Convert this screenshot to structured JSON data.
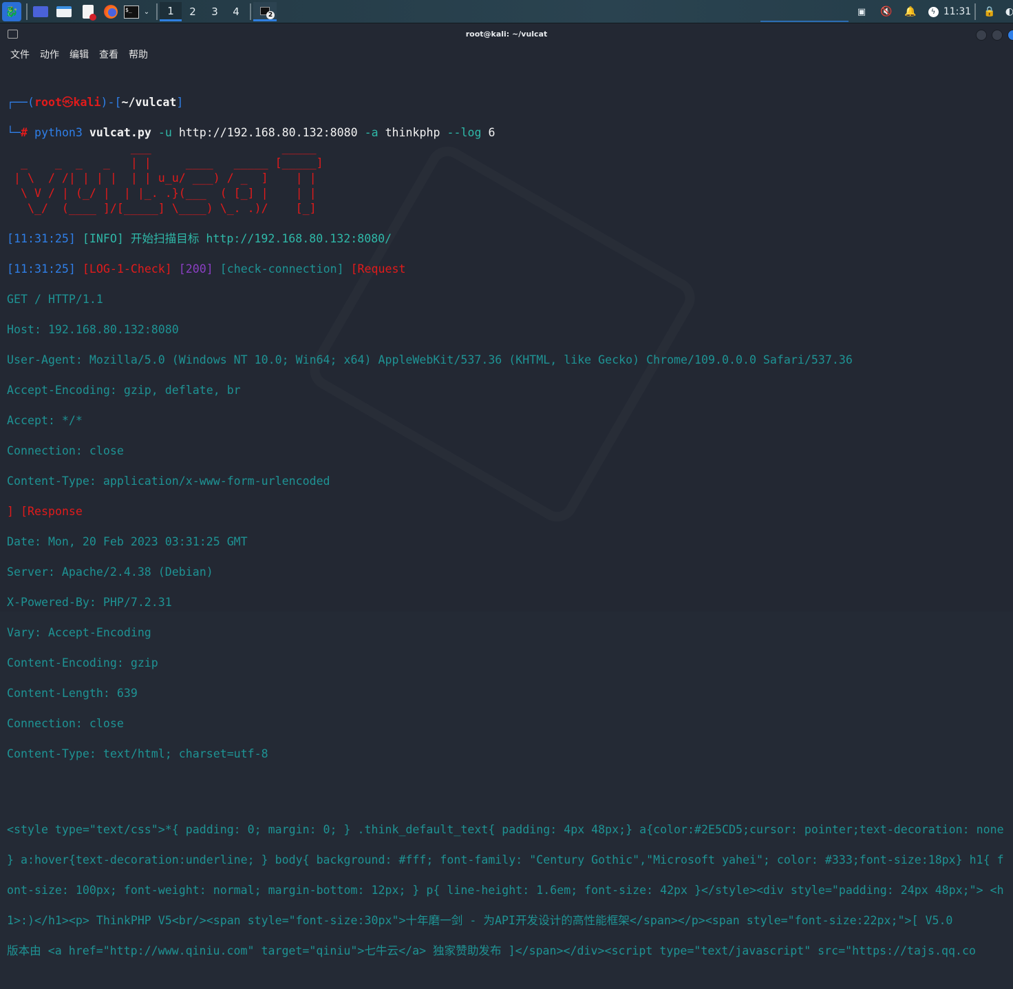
{
  "taskbar": {
    "workspaces": [
      "1",
      "2",
      "3",
      "4"
    ],
    "active_workspace": "1",
    "clock": "11:31",
    "task_badge": "2"
  },
  "window": {
    "title": "root@kali: ~/vulcat",
    "menu": [
      "文件",
      "动作",
      "编辑",
      "查看",
      "帮助"
    ]
  },
  "prompt": {
    "user": "root",
    "sep": "㉿",
    "host": "kali",
    "path": "~/vulcat",
    "hash": "#",
    "cmd": "python3",
    "script": "vulcat.py",
    "flag_u": "-u",
    "url": "http://192.168.80.132:8080",
    "flag_a": "-a",
    "app": "thinkphp",
    "flag_log": "--log",
    "log_level": "6"
  },
  "banner": [
    "                  ___                   _____",
    "  _    _  _   _   | |     ____   _____ [_____]",
    " | \\  / /| | | |  | | u_u/ ___) / _  ]    | |",
    "  \\ V / | (_/ |  | |_. .}(___  ( [_] |    | |",
    "   \\_/  (____ ]/[_____] \\____) \\_. .)/    [_]"
  ],
  "log": {
    "time": "[11:31:25]",
    "info_tag": "[INFO]",
    "info_msg": "开始扫描目标",
    "target": "http://192.168.80.132:8080/",
    "log_tag": "[LOG-1-Check]",
    "status": "[200]",
    "check": "[check-connection]",
    "request": "[Request"
  },
  "request_lines": [
    "GET / HTTP/1.1",
    "Host: 192.168.80.132:8080",
    "User-Agent: Mozilla/5.0 (Windows NT 10.0; Win64; x64) AppleWebKit/537.36 (KHTML, like Gecko) Chrome/109.0.0.0 Safari/537.36",
    "Accept-Encoding: gzip, deflate, br",
    "Accept: */*",
    "Connection: close",
    "Content-Type: application/x-www-form-urlencoded"
  ],
  "response_tag": {
    "bracket": "]",
    "label": "[Response"
  },
  "response_lines": [
    "Date: Mon, 20 Feb 2023 03:31:25 GMT",
    "Server: Apache/2.4.38 (Debian)",
    "X-Powered-By: PHP/7.2.31",
    "Vary: Accept-Encoding",
    "Content-Encoding: gzip",
    "Content-Length: 639",
    "Connection: close",
    "Content-Type: text/html; charset=utf-8"
  ],
  "body_lines": [
    "<style type=\"text/css\">*{ padding: 0; margin: 0; } .think_default_text{ padding: 4px 48px;} a{color:#2E5CD5;cursor: pointer;text-decoration: none",
    "} a:hover{text-decoration:underline; } body{ background: #fff; font-family: \"Century Gothic\",\"Microsoft yahei\"; color: #333;font-size:18px} h1{ f",
    "ont-size: 100px; font-weight: normal; margin-bottom: 12px; } p{ line-height: 1.6em; font-size: 42px }</style><div style=\"padding: 24px 48px;\"> <h",
    "1>:)</h1><p> ThinkPHP V5<br/><span style=\"font-size:30px\">十年磨一剑 - 为API开发设计的高性能框架</span></p><span style=\"font-size:22px;\">[ V5.0",
    "版本由 <a href=\"http://www.qiniu.com\" target=\"qiniu\">七牛云</a> 独家赞助发布 ]</span></div><script type=\"text/javascript\" src=\"https://tajs.qq.co"
  ]
}
